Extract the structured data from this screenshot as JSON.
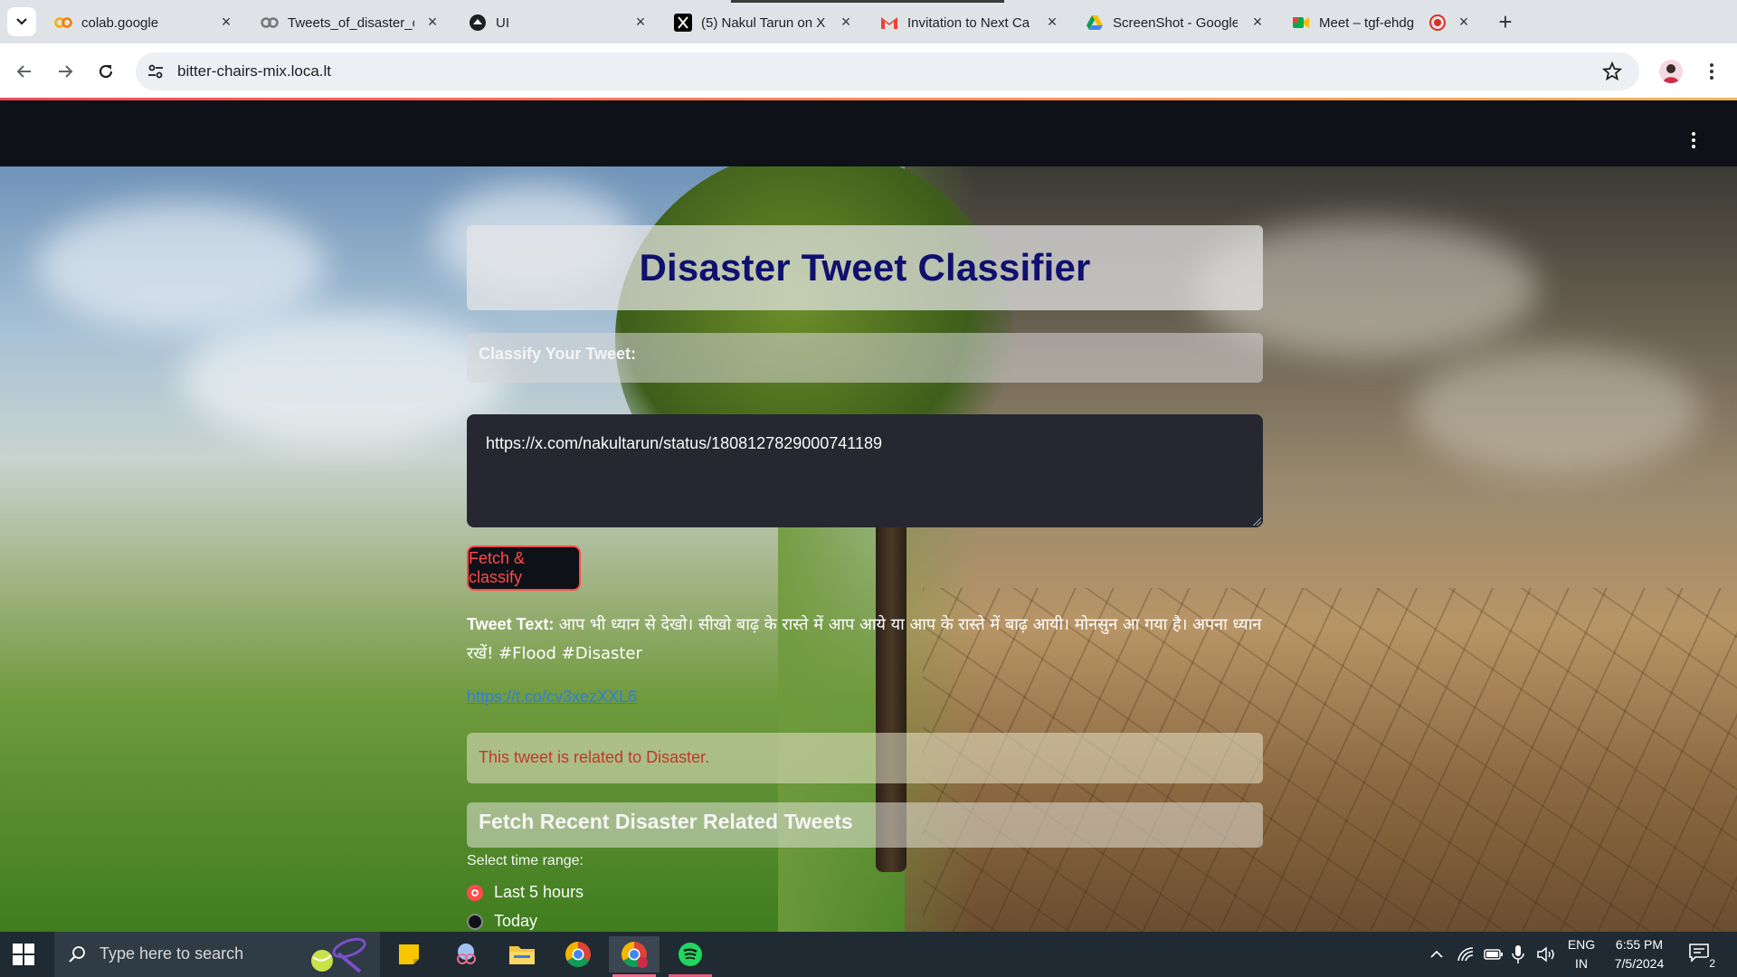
{
  "browser": {
    "tabs": [
      {
        "title": "colab.google",
        "icon": "colab-icon"
      },
      {
        "title": "Tweets_of_disaster_o",
        "icon": "colab-icon"
      },
      {
        "title": "UI",
        "icon": "streamlit-icon"
      },
      {
        "title": "(5) Nakul Tarun on X:",
        "icon": "x-icon"
      },
      {
        "title": "Invitation to Next Ca",
        "icon": "gmail-icon"
      },
      {
        "title": "ScreenShot - Google",
        "icon": "google-drive-icon"
      },
      {
        "title": "Meet – tgf-ehdg",
        "icon": "google-meet-icon"
      }
    ],
    "url": "bitter-chairs-mix.loca.lt"
  },
  "app": {
    "title": "Disaster Tweet Classifier",
    "classify_label": "Classify Your Tweet:",
    "input_value": "https://x.com/nakultarun/status/1808127829000741189",
    "fetch_button": "Fetch & classify",
    "tweet_label": "Tweet Text:",
    "tweet_body": "आप भी ध्यान से देखो। सीखो बाढ़ के रास्ते में आप आये या आप के रास्ते में बाढ़ आयी। मोनसुन आ गया है। अपना ध्यान रखें! #Flood #Disaster",
    "tweet_link": "https://t.co/cv3xezXXL6",
    "result": "This tweet is related to Disaster.",
    "recent_header": "Fetch Recent Disaster Related Tweets",
    "time_range_label": "Select time range:",
    "time_options": [
      "Last 5 hours",
      "Today"
    ],
    "selected_option": "Last 5 hours"
  },
  "taskbar": {
    "search_placeholder": "Type here to search",
    "lang_top": "ENG",
    "lang_bottom": "IN",
    "time": "6:55 PM",
    "date": "7/5/2024",
    "notification_count": "2"
  },
  "colors": {
    "accent": "#ff4b4b",
    "title": "#10106f",
    "app_header": "#0e1117"
  }
}
